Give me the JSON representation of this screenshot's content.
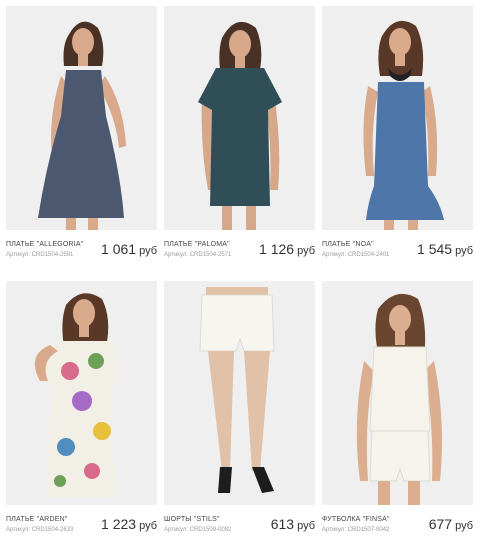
{
  "products": [
    {
      "name": "ПЛАТЬЕ \"ALLEGORIA\"",
      "sku": "Артикул: CRD1504-2591",
      "price": "1 061",
      "currency": "руб",
      "image": "model-in-navy-dotted-slip-dress"
    },
    {
      "name": "ПЛАТЬЕ \"PALOMA\"",
      "sku": "Артикул: CRD1504-2571",
      "price": "1 126",
      "currency": "руб",
      "image": "model-in-teal-floral-dress"
    },
    {
      "name": "ПЛАТЬЕ \"NOA\"",
      "sku": "Артикул: CRD1504-2401",
      "price": "1 545",
      "currency": "руб",
      "image": "model-in-blue-ruffle-hem-dress"
    },
    {
      "name": "ПЛАТЬЕ \"ARDEN\"",
      "sku": "Артикул: CRD1504-2633",
      "price": "1 223",
      "currency": "руб",
      "image": "model-in-white-floral-print-dress"
    },
    {
      "name": "ШОРТЫ \"STILS\"",
      "sku": "Артикул: CRD1509-0082",
      "price": "613",
      "currency": "руб",
      "image": "legs-in-white-shorts-and-heels"
    },
    {
      "name": "ФУТБОЛКА \"FINSA\"",
      "sku": "Артикул: CRD1507-0042",
      "price": "677",
      "currency": "руб",
      "image": "model-in-white-top-and-shorts"
    }
  ]
}
